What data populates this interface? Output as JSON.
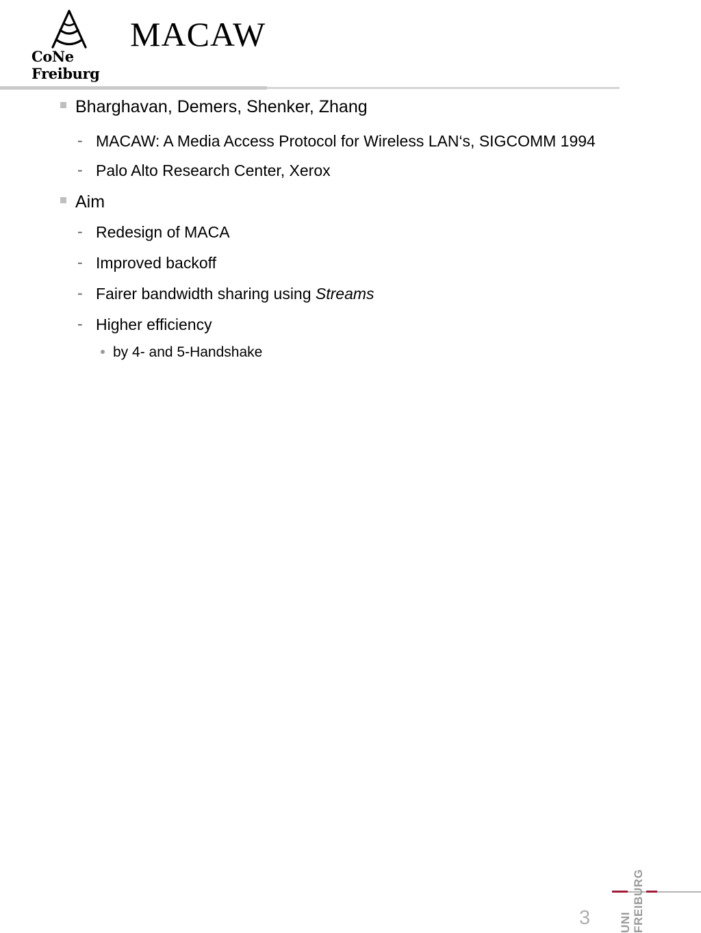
{
  "header": {
    "title": "MACAW",
    "logo": {
      "icon": "antenna-tower-icon",
      "line1": "Co",
      "line1b": "Ne",
      "line2": "Freiburg",
      "full": "CoNe Freiburg"
    }
  },
  "body": {
    "bullets": [
      {
        "level": 1,
        "marker": "square",
        "text": "Bharghavan, Demers, Shenker, Zhang"
      },
      {
        "level": 2,
        "marker": "-",
        "text": "MACAW: A Media Access Protocol for Wireless LAN‘s, SIGCOMM 1994"
      },
      {
        "level": 2,
        "marker": "-",
        "text": "Palo Alto Research Center, Xerox"
      },
      {
        "level": 1,
        "marker": "square",
        "text": "Aim"
      },
      {
        "level": 2,
        "marker": "-",
        "text": "Redesign of MACA"
      },
      {
        "level": 2,
        "marker": "-",
        "text": "Improved backoff"
      },
      {
        "level": 2,
        "marker": "-",
        "text_pre": "Fairer bandwidth sharing using ",
        "text_em": "Streams",
        "text": "Fairer bandwidth sharing using Streams"
      },
      {
        "level": 2,
        "marker": "-",
        "text": "Higher efficiency"
      },
      {
        "level": 3,
        "marker": "•",
        "text": "by 4- and 5-Handshake"
      }
    ]
  },
  "footer": {
    "page_number": "3",
    "university": {
      "line1": "UNI",
      "line2": "FREIBURG"
    }
  },
  "colors": {
    "accent_red": "#a01a37",
    "rule_gray": "#c9c9c9",
    "muted_gray": "#9b9b9b",
    "bullet_gray": "#bfbfbf",
    "text": "#000000",
    "background": "#ffffff"
  }
}
